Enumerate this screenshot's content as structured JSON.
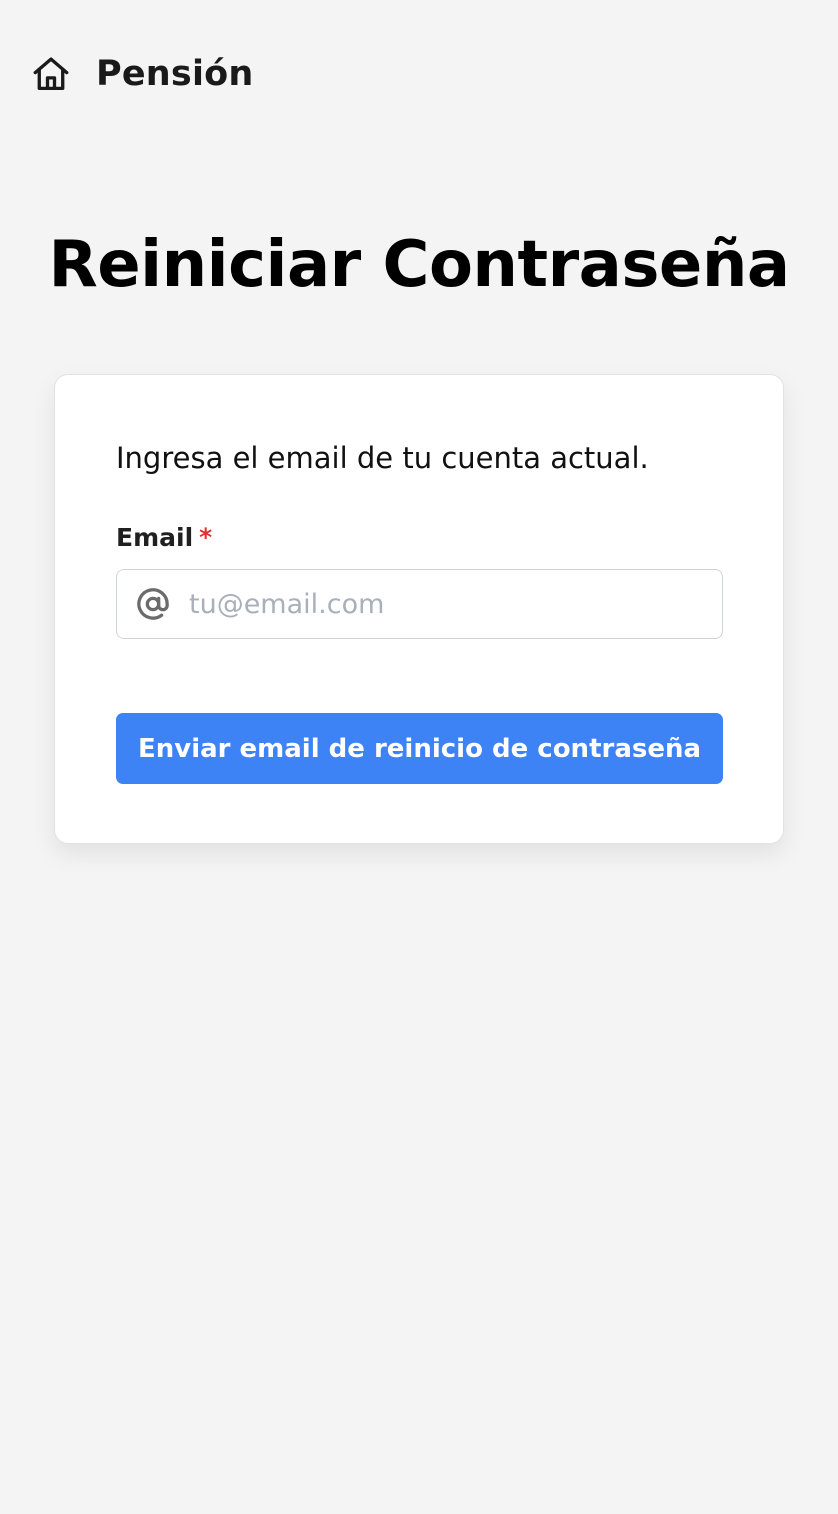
{
  "header": {
    "brand": "Pensión",
    "icon": "home-icon"
  },
  "page": {
    "title": "Reiniciar Contraseña"
  },
  "form": {
    "instructions": "Ingresa el email de tu cuenta actual.",
    "email_label": "Email",
    "required_mark": "*",
    "email_placeholder": "tu@email.com",
    "email_value": "",
    "email_icon": "at-icon",
    "submit_label": "Enviar email de reinicio de contraseña"
  },
  "colors": {
    "background": "#f4f4f4",
    "card": "#ffffff",
    "primary_button": "#3d83f5",
    "required": "#e03131",
    "placeholder": "#a9b0ba"
  }
}
